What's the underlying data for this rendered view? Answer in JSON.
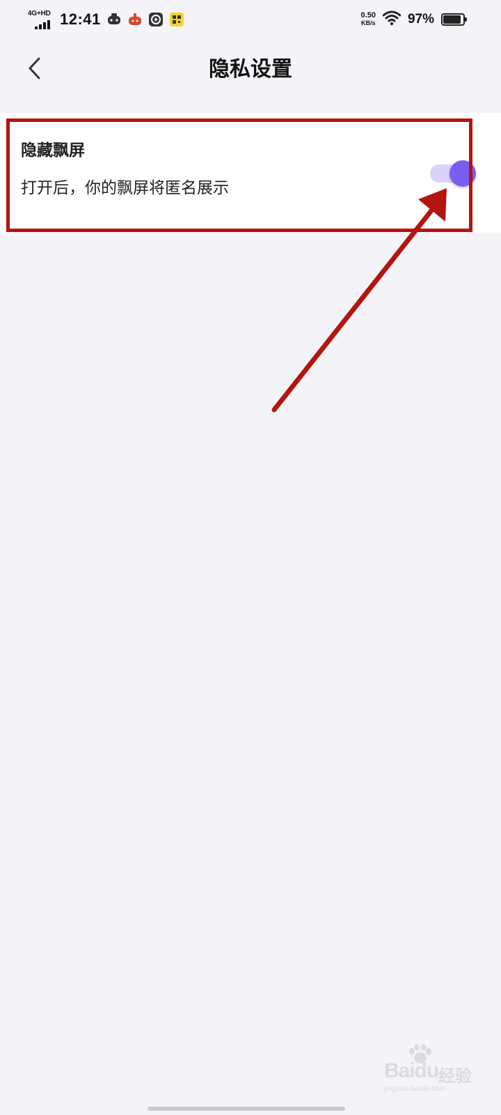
{
  "status_bar": {
    "network": "4G+HD",
    "time": "12:41",
    "notification_icons": [
      "game-controller-icon",
      "red-app-icon",
      "media-player-icon",
      "yellow-app-icon"
    ],
    "net_speed_value": "0.50",
    "net_speed_unit": "KB/s",
    "wifi_icon": "wifi-icon",
    "battery_percent": "97%",
    "battery_level": 0.97
  },
  "header": {
    "back_icon": "chevron-left-icon",
    "title": "隐私设置"
  },
  "settings": {
    "items": [
      {
        "title": "隐藏飘屏",
        "description": "打开后，你的飘屏将匿名展示",
        "enabled": true
      }
    ]
  },
  "colors": {
    "background": "#f4f4f8",
    "card": "#ffffff",
    "toggle_knob": "#7b5cf0",
    "toggle_track": "#d9d2fb",
    "annotation": "#b3150f"
  },
  "watermark": {
    "logo_text": "Baidu",
    "cn_text": "经验",
    "url": "jingyan.baidu.com"
  }
}
